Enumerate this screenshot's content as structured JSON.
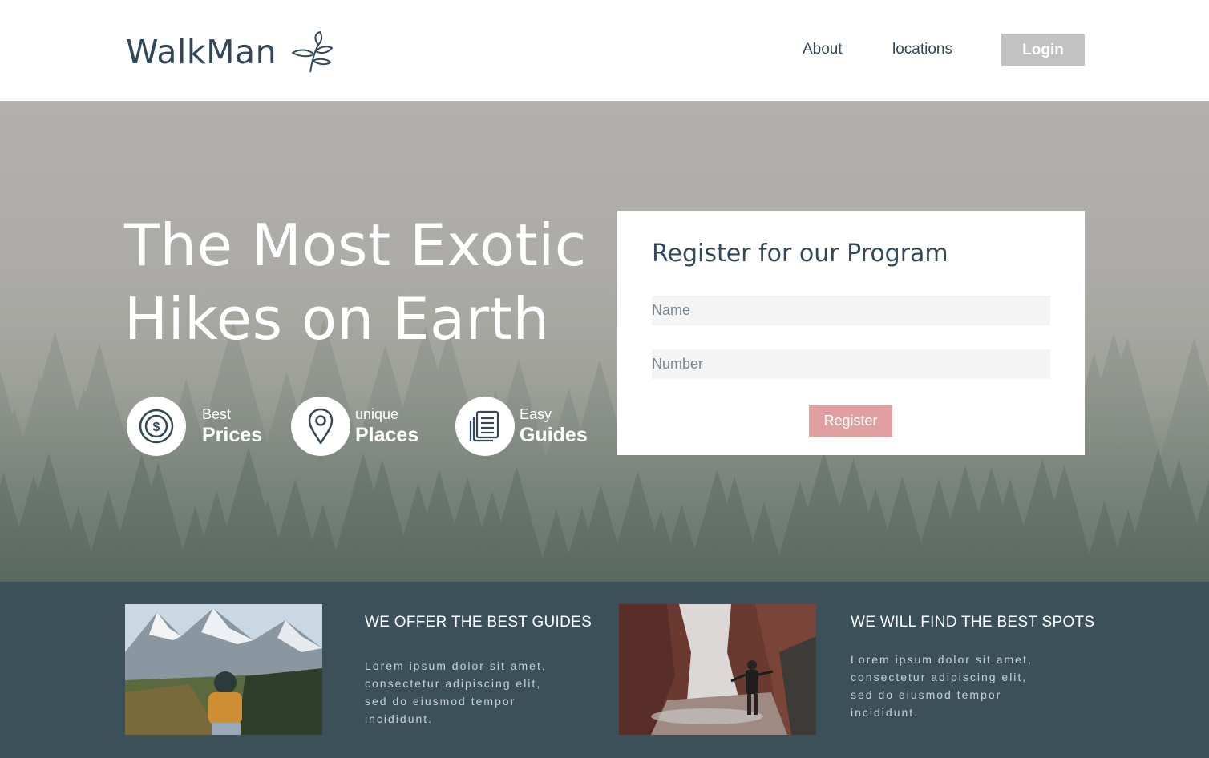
{
  "header": {
    "brand": "WalkMan",
    "nav": [
      {
        "label": "About"
      },
      {
        "label": "locations"
      }
    ],
    "login_label": "Login"
  },
  "hero": {
    "title_line1": "The Most Exotic",
    "title_line2": "Hikes on Earth",
    "features": [
      {
        "small": "Best",
        "big": "Prices",
        "icon": "dollar-coin-icon"
      },
      {
        "small": "unique",
        "big": "Places",
        "icon": "map-pin-icon"
      },
      {
        "small": "Easy",
        "big": "Guides",
        "icon": "document-stack-icon"
      }
    ]
  },
  "register": {
    "title": "Register for our Program",
    "name_placeholder": "Name",
    "number_placeholder": "Number",
    "button_label": "Register"
  },
  "offers": [
    {
      "title": "WE OFFER THE BEST GUIDES",
      "body_lines": [
        "Lorem ipsum dolor sit amet,",
        "consectetur adipiscing elit,",
        "sed do eiusmod tempor",
        "incididunt."
      ]
    },
    {
      "title": "WE WILL FIND THE BEST SPOTS",
      "body_lines": [
        "Lorem ipsum dolor sit amet,",
        "consectetur adipiscing elit,",
        "sed do eiusmod tempor",
        "incididunt."
      ]
    }
  ],
  "colors": {
    "navy": "#33475a",
    "login_bg": "#c2c2c2",
    "register_btn": "#e09fa0",
    "bottom_bg": "#3c5059"
  }
}
